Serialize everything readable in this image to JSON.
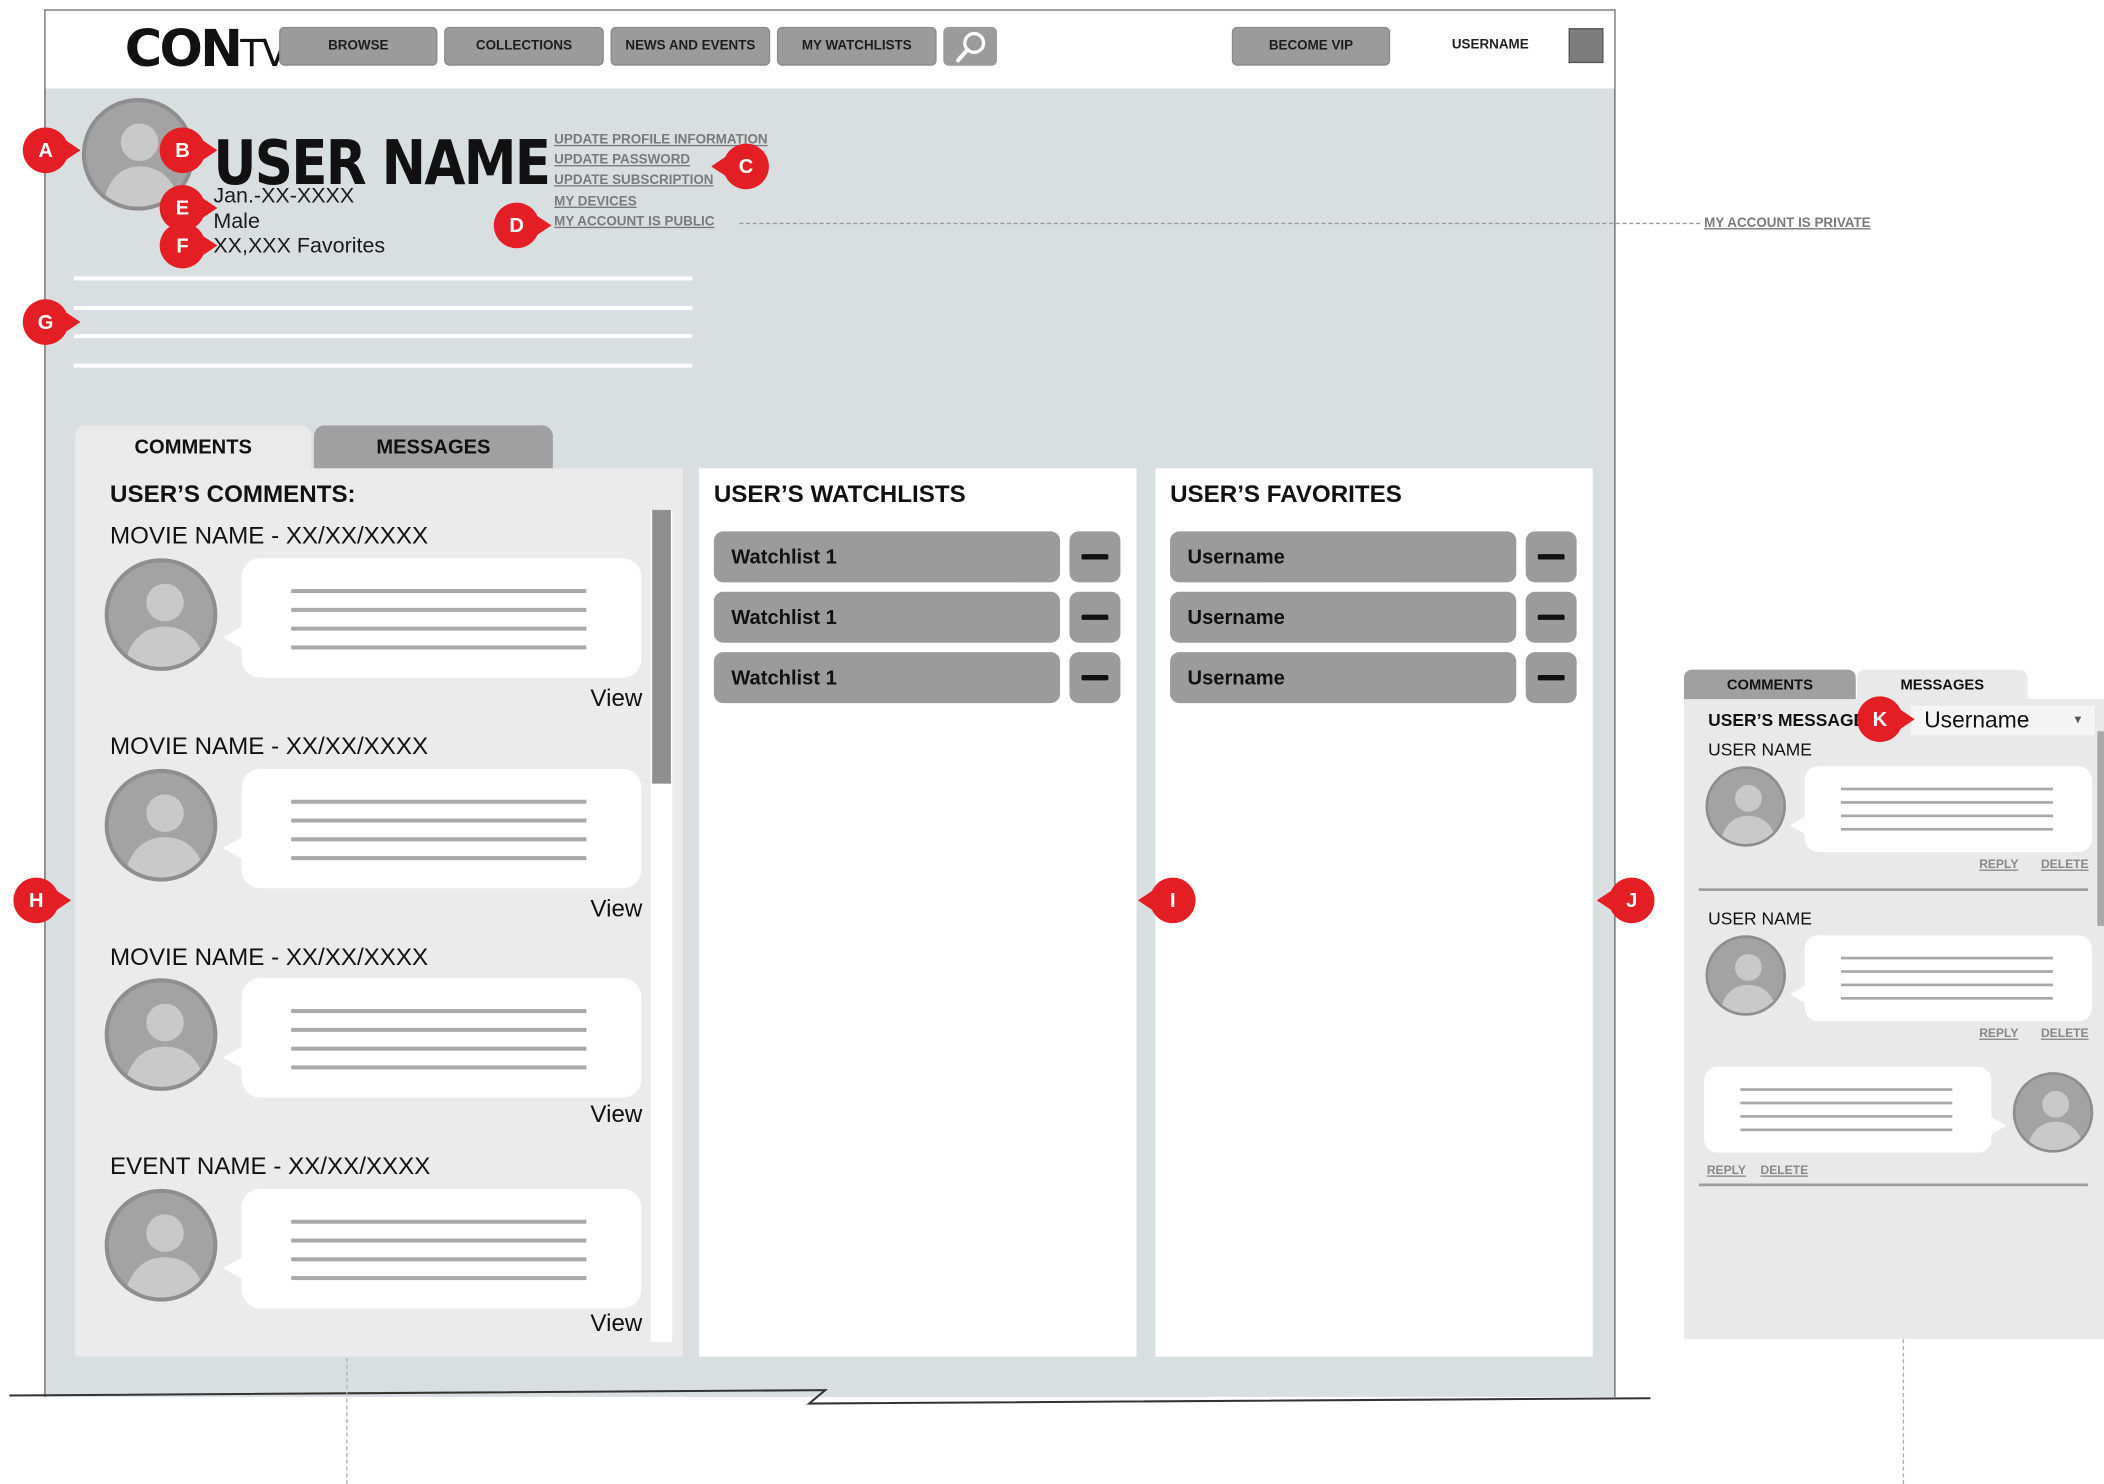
{
  "header": {
    "logo_main": "CON",
    "logo_tv": "TV",
    "nav": [
      "BROWSE",
      "COLLECTIONS",
      "NEWS AND EVENTS",
      "MY WATCHLISTS"
    ],
    "vip_label": "BECOME VIP",
    "username": "USERNAME"
  },
  "profile": {
    "name": "USER NAME",
    "birthdate": "Jan.-XX-XXXX",
    "gender": "Male",
    "favorites": "XX,XXX Favorites",
    "links": [
      "UPDATE PROFILE INFORMATION",
      "UPDATE PASSWORD",
      "UPDATE SUBSCRIPTION",
      "MY DEVICES",
      "MY ACCOUNT IS PUBLIC"
    ],
    "alt_privacy_link": "MY ACCOUNT IS PRIVATE"
  },
  "markers": {
    "a": "A",
    "b": "B",
    "c": "C",
    "d": "D",
    "e": "E",
    "f": "F",
    "g": "G",
    "h": "H",
    "i": "I",
    "j": "J",
    "k": "K"
  },
  "tabs": [
    "COMMENTS",
    "MESSAGES"
  ],
  "comments": {
    "title": "USER’S COMMENTS:",
    "view_label": "View",
    "items": [
      {
        "title": "MOVIE NAME - XX/XX/XXXX"
      },
      {
        "title": "MOVIE NAME - XX/XX/XXXX"
      },
      {
        "title": "MOVIE NAME - XX/XX/XXXX"
      },
      {
        "title": "EVENT NAME - XX/XX/XXXX"
      }
    ]
  },
  "watchlists": {
    "title": "USER’S WATCHLISTS",
    "items": [
      "Watchlist 1",
      "Watchlist 1",
      "Watchlist 1"
    ]
  },
  "favorites": {
    "title": "USER’S FAVORITES",
    "items": [
      "Username",
      "Username",
      "Username"
    ]
  },
  "messages_panel": {
    "tabs": [
      "COMMENTS",
      "MESSAGES"
    ],
    "title": "USER’S MESSAGES",
    "select_value": "Username",
    "threads": [
      {
        "user": "USER NAME",
        "reply": "REPLY",
        "delete": "DELETE"
      },
      {
        "user": "USER NAME",
        "reply": "REPLY",
        "delete": "DELETE"
      },
      {
        "reply": "REPLY",
        "delete": "DELETE"
      }
    ]
  },
  "colors": {
    "marker_red": "#e31e24",
    "button_gray": "#9b9b9b",
    "page_bg": "#d9dee0"
  }
}
